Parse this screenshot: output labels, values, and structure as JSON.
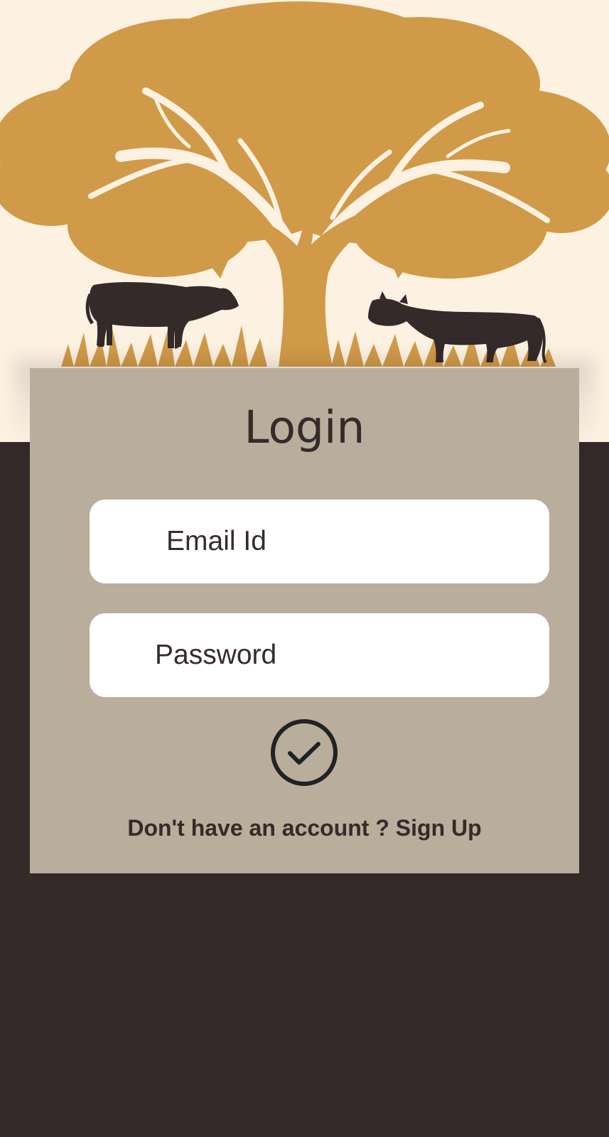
{
  "login": {
    "title": "Login",
    "email_placeholder": "Email Id",
    "password_placeholder": "Password",
    "submit_icon": "check-circle-icon",
    "signup_prompt": "Don't have an account ?",
    "signup_link": "Sign Up"
  },
  "hero": {
    "illustration": "tree-with-cattle-illustration"
  },
  "colors": {
    "header_background": "#fdf2e2",
    "tree": "#d19a48",
    "cattle": "#332a29",
    "card": "#b9ae9b",
    "page_background": "#332a29",
    "input_background": "#ffffff",
    "text": "#342b2a"
  }
}
